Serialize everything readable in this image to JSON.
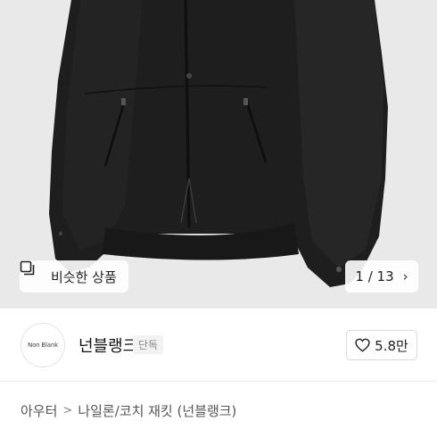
{
  "product_image": {
    "similar_button_label": "비슷한 상품",
    "pager": {
      "current": "1",
      "separator": "/",
      "total": "13"
    }
  },
  "brand": {
    "logo_text": "Non Blank",
    "name": "넌블랭크",
    "tag": "단독"
  },
  "like": {
    "count": "5.8만"
  },
  "breadcrumb": {
    "category": "아우터",
    "subcategory": "나일론/코치 재킷 (넌블랭크)"
  },
  "colors": {
    "image_bg": "#e9e9e9",
    "jacket": "#1e1e1e",
    "tag_bg": "#f2f2f2"
  }
}
